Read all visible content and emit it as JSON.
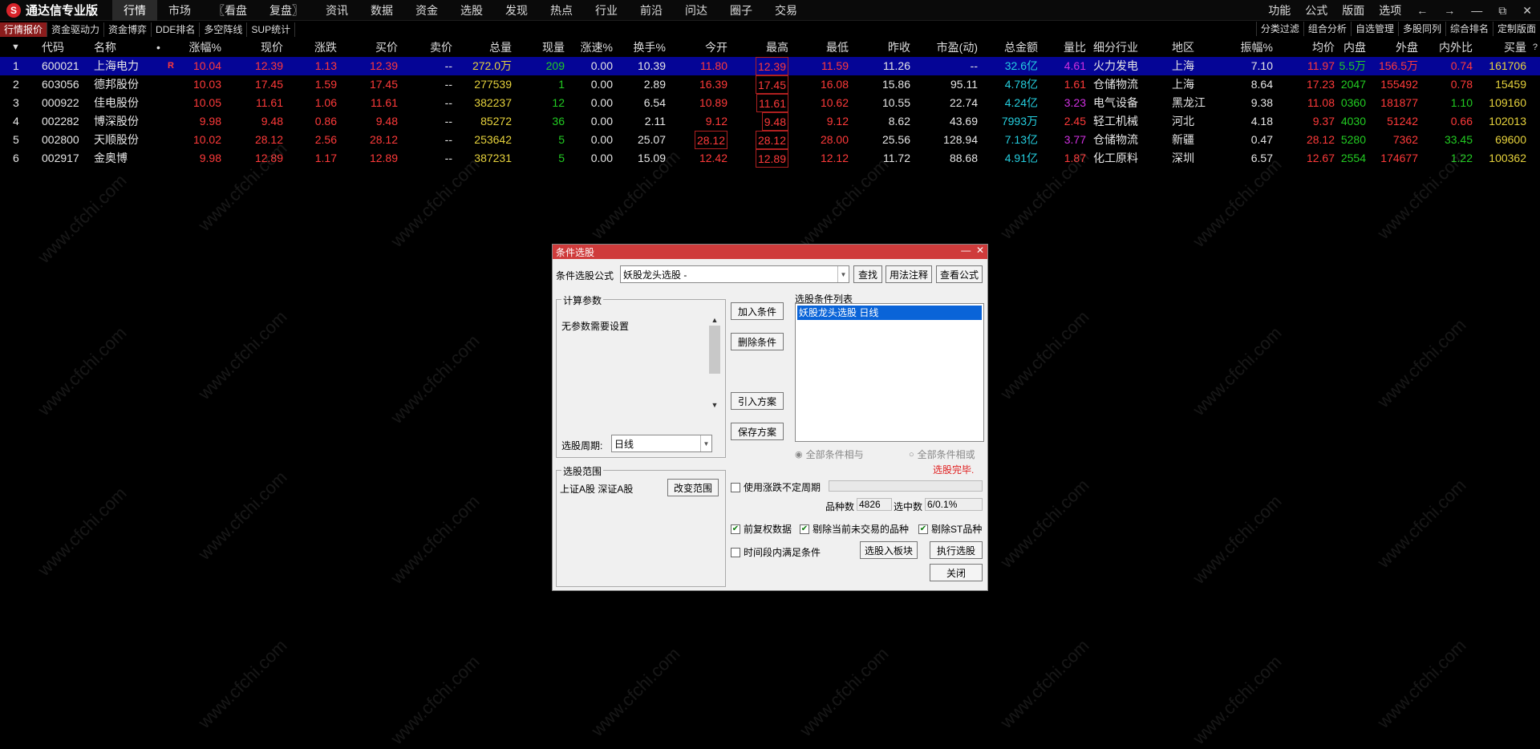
{
  "app": {
    "title": "通达信专业版",
    "logo_char": "S"
  },
  "menu": [
    "行情",
    "市场",
    "〖看盘",
    "复盘〗",
    "资讯",
    "数据",
    "资金",
    "选股",
    "发现",
    "热点",
    "行业",
    "前沿",
    "问达",
    "圈子",
    "交易"
  ],
  "right_menu": [
    "功能",
    "公式",
    "版面",
    "选项"
  ],
  "window_controls": {
    "back": "←",
    "forward": "→",
    "min": "—",
    "restore": "⧉",
    "close": "✕"
  },
  "subtabs": [
    "行情报价",
    "资金驱动力",
    "资金博弈",
    "DDE排名",
    "多空阵线",
    "SUP统计"
  ],
  "subtabs_right": [
    "分类过滤",
    "组合分析",
    "自选管理",
    "多股同列",
    "综合排名",
    "定制版面"
  ],
  "help_mark": "?",
  "columns": [
    "代码",
    "名称",
    "•",
    "涨幅%",
    "现价",
    "涨跌",
    "买价",
    "卖价",
    "总量",
    "现量",
    "涨速%",
    "换手%",
    "今开",
    "最高",
    "最低",
    "昨收",
    "市盈(动)",
    "总金额",
    "量比",
    "细分行业",
    "地区",
    "振幅%",
    "均价",
    "内盘",
    "外盘",
    "内外比",
    "买量"
  ],
  "rows": [
    {
      "idx": "1",
      "code": "600021",
      "name": "上海电力",
      "flag": "R",
      "chg_pct": "10.04",
      "price": "12.39",
      "chg": "1.13",
      "bid": "12.39",
      "ask": "--",
      "vol": "272.0万",
      "cur_vol": "209",
      "speed": "0.00",
      "turnover": "10.39",
      "open": "11.80",
      "high": "12.39",
      "low": "11.59",
      "prev": "11.26",
      "pe": "--",
      "amount": "32.6亿",
      "vol_ratio": "4.61",
      "industry": "火力发电",
      "region": "上海",
      "amplitude": "7.10",
      "avg": "11.97",
      "inner": "5.5万",
      "outer": "156.5万",
      "io_ratio": "0.74",
      "bid_vol": "161706"
    },
    {
      "idx": "2",
      "code": "603056",
      "name": "德邦股份",
      "flag": "",
      "chg_pct": "10.03",
      "price": "17.45",
      "chg": "1.59",
      "bid": "17.45",
      "ask": "--",
      "vol": "277539",
      "cur_vol": "1",
      "speed": "0.00",
      "turnover": "2.89",
      "open": "16.39",
      "high": "17.45",
      "low": "16.08",
      "prev": "15.86",
      "pe": "95.11",
      "amount": "4.78亿",
      "vol_ratio": "1.61",
      "industry": "仓储物流",
      "region": "上海",
      "amplitude": "8.64",
      "avg": "17.23",
      "inner": "2047",
      "outer": "155492",
      "io_ratio": "0.78",
      "bid_vol": "15459"
    },
    {
      "idx": "3",
      "code": "000922",
      "name": "佳电股份",
      "flag": "",
      "chg_pct": "10.05",
      "price": "11.61",
      "chg": "1.06",
      "bid": "11.61",
      "ask": "--",
      "vol": "382237",
      "cur_vol": "12",
      "speed": "0.00",
      "turnover": "6.54",
      "open": "10.89",
      "high": "11.61",
      "low": "10.62",
      "prev": "10.55",
      "pe": "22.74",
      "amount": "4.24亿",
      "vol_ratio": "3.23",
      "industry": "电气设备",
      "region": "黑龙江",
      "amplitude": "9.38",
      "avg": "11.08",
      "inner": "0360",
      "outer": "181877",
      "io_ratio": "1.10",
      "bid_vol": "109160"
    },
    {
      "idx": "4",
      "code": "002282",
      "name": "博深股份",
      "flag": "",
      "chg_pct": "9.98",
      "price": "9.48",
      "chg": "0.86",
      "bid": "9.48",
      "ask": "--",
      "vol": "85272",
      "cur_vol": "36",
      "speed": "0.00",
      "turnover": "2.11",
      "open": "9.12",
      "high": "9.48",
      "low": "9.12",
      "prev": "8.62",
      "pe": "43.69",
      "amount": "7993万",
      "vol_ratio": "2.45",
      "industry": "轻工机械",
      "region": "河北",
      "amplitude": "4.18",
      "avg": "9.37",
      "inner": "4030",
      "outer": "51242",
      "io_ratio": "0.66",
      "bid_vol": "102013"
    },
    {
      "idx": "5",
      "code": "002800",
      "name": "天顺股份",
      "flag": "",
      "chg_pct": "10.02",
      "price": "28.12",
      "chg": "2.56",
      "bid": "28.12",
      "ask": "--",
      "vol": "253642",
      "cur_vol": "5",
      "speed": "0.00",
      "turnover": "25.07",
      "open": "28.12",
      "high": "28.12",
      "low": "28.00",
      "prev": "25.56",
      "pe": "128.94",
      "amount": "7.13亿",
      "vol_ratio": "3.77",
      "industry": "仓储物流",
      "region": "新疆",
      "amplitude": "0.47",
      "avg": "28.12",
      "inner": "5280",
      "outer": "7362",
      "io_ratio": "33.45",
      "bid_vol": "69600"
    },
    {
      "idx": "6",
      "code": "002917",
      "name": "金奥博",
      "flag": "",
      "chg_pct": "9.98",
      "price": "12.89",
      "chg": "1.17",
      "bid": "12.89",
      "ask": "--",
      "vol": "387231",
      "cur_vol": "5",
      "speed": "0.00",
      "turnover": "15.09",
      "open": "12.42",
      "high": "12.89",
      "low": "12.12",
      "prev": "11.72",
      "pe": "88.68",
      "amount": "4.91亿",
      "vol_ratio": "1.87",
      "industry": "化工原料",
      "region": "深圳",
      "amplitude": "6.57",
      "avg": "12.67",
      "inner": "2554",
      "outer": "174677",
      "io_ratio": "1.22",
      "bid_vol": "100362"
    }
  ],
  "watermark": "www.cfchi.com",
  "dialog": {
    "title": "条件选股",
    "formula_label": "条件选股公式",
    "formula_value": "妖股龙头选股 -",
    "btn_find": "查找",
    "btn_usage": "用法注释",
    "btn_view": "查看公式",
    "params_group": "计算参数",
    "params_text": "无参数需要设置",
    "period_label": "选股周期:",
    "period_value": "日线",
    "btn_add": "加入条件",
    "btn_delete": "删除条件",
    "btn_import": "引入方案",
    "btn_save": "保存方案",
    "cond_list_label": "选股条件列表",
    "cond_items": [
      "妖股龙头选股  日线"
    ],
    "radio_and": "全部条件相与",
    "radio_or": "全部条件相或",
    "status": "选股完毕.",
    "range_group": "选股范围",
    "range_text": "上证A股 深证A股",
    "btn_change_range": "改变范围",
    "chk_period": "使用涨跌不定周期",
    "count_label": "品种数",
    "count_value": "4826",
    "selected_label": "选中数",
    "selected_value": "6/0.1%",
    "chk_fq": "前复权数据",
    "chk_notrade": "剔除当前未交易的品种",
    "chk_st": "剔除ST品种",
    "chk_time": "时间段内满足条件",
    "btn_to_block": "选股入板块",
    "btn_run": "执行选股",
    "btn_close": "关闭"
  }
}
